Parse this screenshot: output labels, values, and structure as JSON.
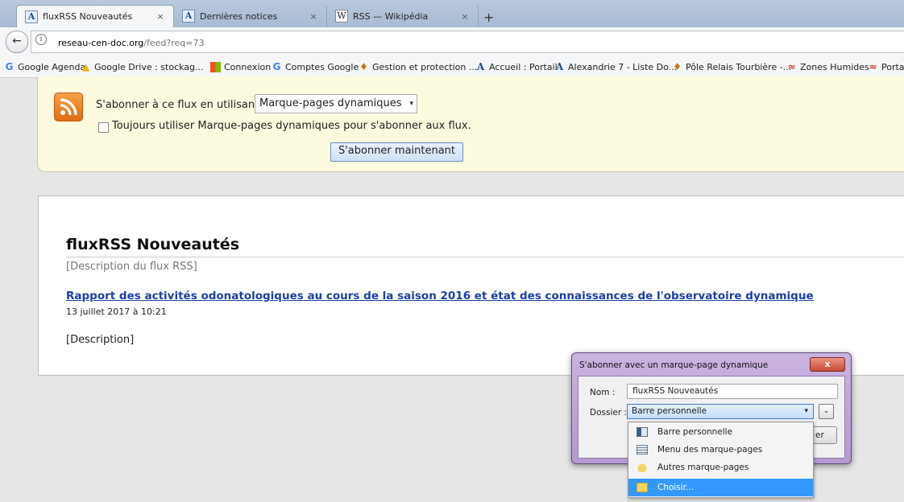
{
  "tabs": [
    {
      "title": "fluxRSS Nouveautés",
      "icon": "alexandrie-favicon",
      "active": true
    },
    {
      "title": "Dernières notices",
      "icon": "alexandrie-favicon",
      "active": false
    },
    {
      "title": "RSS — Wikipédia",
      "icon": "wikipedia-favicon",
      "active": false
    }
  ],
  "newtab_label": "+",
  "tab_close": "×",
  "navbar": {
    "back": "←",
    "info": "i",
    "url_host": "reseau-cen-doc.org",
    "url_path": "/feed?req=73"
  },
  "bookmarks": [
    {
      "label": "Google Agenda",
      "icon": "G"
    },
    {
      "label": "Google Drive : stockag...",
      "icon": "▲"
    },
    {
      "label": "Connexion",
      "icon": ""
    },
    {
      "label": "Comptes Google",
      "icon": "G"
    },
    {
      "label": "Gestion et protection ...",
      "icon": "♦"
    },
    {
      "label": "Accueil : Portail",
      "icon": "A"
    },
    {
      "label": "Alexandrie 7 - Liste Do...",
      "icon": "A"
    },
    {
      "label": "Pôle Relais Tourbière -...",
      "icon": "♦"
    },
    {
      "label": "Zones Humides",
      "icon": "≈"
    },
    {
      "label": "Portai",
      "icon": "≈"
    }
  ],
  "subscribe": {
    "label": "S'abonner à ce flux en utilisant",
    "select_value": "Marque-pages dynamiques",
    "select_arrow": "▾",
    "always_label": "Toujours utiliser Marque-pages dynamiques pour s'abonner aux flux.",
    "button": "S'abonner maintenant"
  },
  "feed": {
    "title": "fluxRSS Nouveautés",
    "description": "[Description du flux RSS]",
    "entry_title": "Rapport des activités odonatologiques au cours de la saison 2016 et état des connaissances de l'observatoire dynamique",
    "entry_date": "13 juillet 2017 à 10:21",
    "entry_description": "[Description]"
  },
  "dialog": {
    "title": "S'abonner avec un marque-page dynamique",
    "close": "x",
    "nom_label": "Nom :",
    "nom_value": "fluxRSS Nouveautés",
    "dossier_label": "Dossier :",
    "dossier_value": "Barre personnelle",
    "dossier_arrow": "▾",
    "expand": "⌄",
    "partial_button": "er"
  },
  "dropdown": [
    {
      "label": "Barre personnelle",
      "icon": "toolbar-icon",
      "selected": false
    },
    {
      "label": "Menu des marque-pages",
      "icon": "menu-icon",
      "selected": false
    },
    {
      "label": "Autres marque-pages",
      "icon": "other-bookmarks-icon",
      "selected": false
    },
    {
      "label": "Choisir...",
      "icon": "folder-icon",
      "selected": true
    }
  ]
}
